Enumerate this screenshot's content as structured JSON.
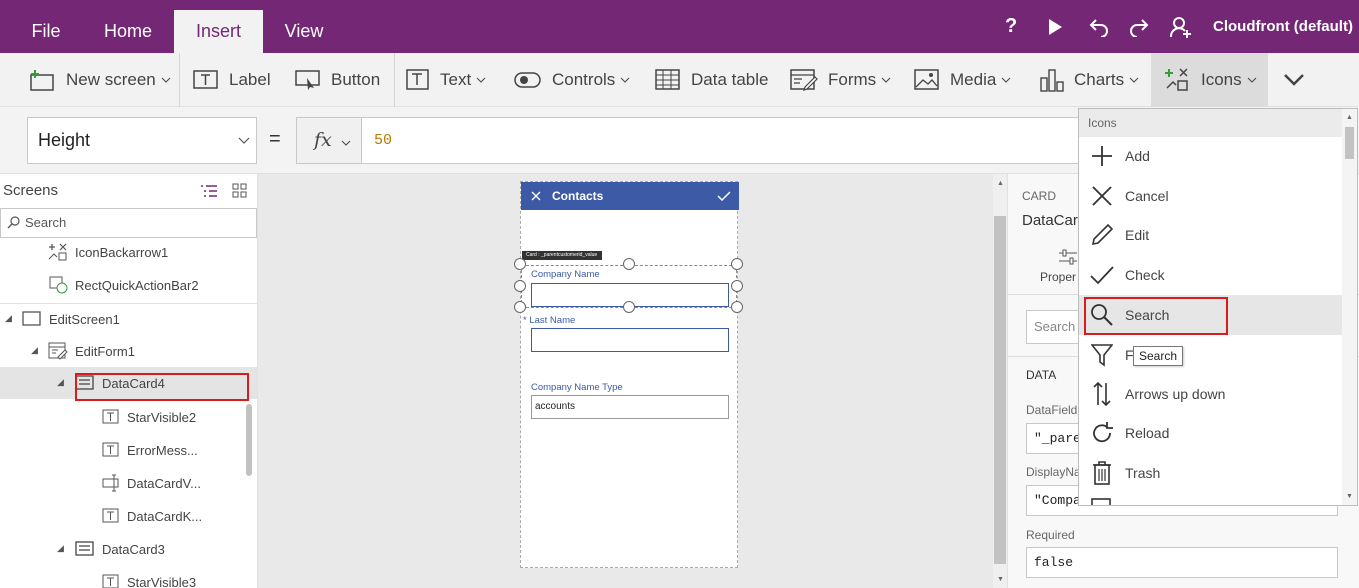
{
  "menu": {
    "file": "File",
    "home": "Home",
    "insert": "Insert",
    "view": "View"
  },
  "topbar": {
    "help": "?",
    "account": "Cloudfront (default)"
  },
  "ribbon": {
    "new_screen": "New screen",
    "label": "Label",
    "button": "Button",
    "text": "Text",
    "controls": "Controls",
    "data_table": "Data table",
    "forms": "Forms",
    "media": "Media",
    "charts": "Charts",
    "icons": "Icons"
  },
  "formula": {
    "property": "Height",
    "equals": "=",
    "fx": "fx",
    "value": "50"
  },
  "left_panel": {
    "title": "Screens",
    "search_placeholder": "Search",
    "tree": [
      {
        "label": "IconBackarrow1"
      },
      {
        "label": "RectQuickActionBar2"
      },
      {
        "label": "EditScreen1"
      },
      {
        "label": "EditForm1"
      },
      {
        "label": "DataCard4"
      },
      {
        "label": "StarVisible2"
      },
      {
        "label": "ErrorMess..."
      },
      {
        "label": "DataCardV..."
      },
      {
        "label": "DataCardK..."
      },
      {
        "label": "DataCard3"
      },
      {
        "label": "StarVisible3"
      }
    ]
  },
  "phone": {
    "title": "Contacts",
    "tag": "Card : _parentcustomerid_value",
    "company_name_label": "Company Name",
    "last_name_label": "* Last Name",
    "company_type_label": "Company Name Type",
    "company_type_value": "accounts"
  },
  "right_panel": {
    "card_label": "CARD",
    "card_name": "DataCar",
    "properties_tab": "Proper",
    "search_placeholder": "Search",
    "data_header": "DATA",
    "datafield_label": "DataField",
    "datafield_value": "\"_pare",
    "displayname_label": "DisplayNa",
    "displayname_value": "\"Compa",
    "required_label": "Required",
    "required_value": "false"
  },
  "icons_dropdown": {
    "header": "Icons",
    "items": [
      {
        "label": "Add",
        "icon": "plus-icon"
      },
      {
        "label": "Cancel",
        "icon": "x-icon"
      },
      {
        "label": "Edit",
        "icon": "pencil-icon"
      },
      {
        "label": "Check",
        "icon": "check-icon"
      },
      {
        "label": "Search",
        "icon": "magnifier-icon"
      },
      {
        "label": "F",
        "icon": "filter-icon"
      },
      {
        "label": "Arrows up down",
        "icon": "arrows-up-down-icon"
      },
      {
        "label": "Reload",
        "icon": "reload-icon"
      },
      {
        "label": "Trash",
        "icon": "trash-icon"
      }
    ],
    "tooltip": "Search"
  },
  "colors": {
    "brand": "#742774",
    "phone_header": "#3c5aa6",
    "highlight": "#d81c1c"
  }
}
